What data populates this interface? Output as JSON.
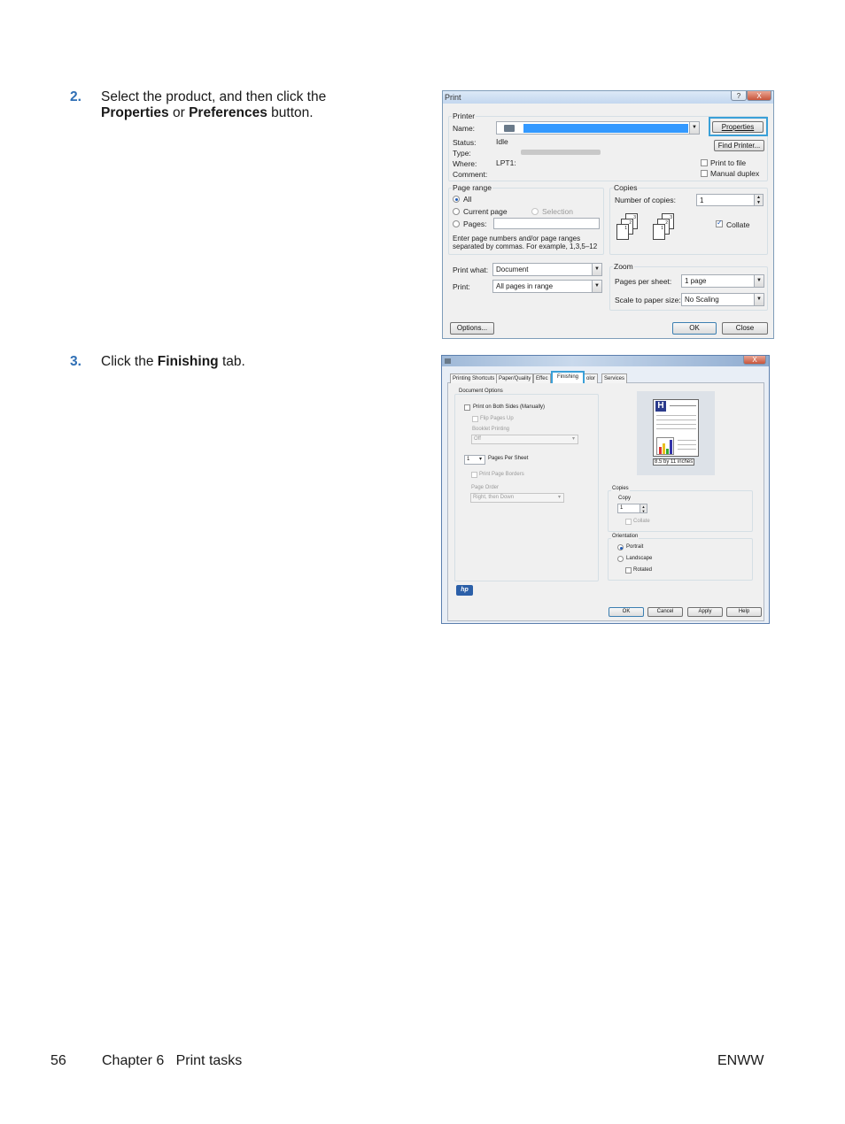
{
  "steps": [
    {
      "number": "2.",
      "line1": "Select the product, and then click the",
      "line2_bold1": "Properties",
      "line2_mid": " or ",
      "line2_bold2": "Preferences",
      "line2_end": " button."
    },
    {
      "number": "3.",
      "pre": "Click the ",
      "bold": "Finishing",
      "post": " tab."
    }
  ],
  "print_dialog": {
    "title": "Print",
    "help_btn": "?",
    "close_btn": "X",
    "printer_group": "Printer",
    "name_label": "Name:",
    "status_label": "Status:",
    "status_value": "Idle",
    "type_label": "Type:",
    "where_label": "Where:",
    "where_value": "LPT1:",
    "comment_label": "Comment:",
    "properties_btn": "Properties",
    "find_printer_btn": "Find Printer...",
    "print_to_file": "Print to file",
    "manual_duplex": "Manual duplex",
    "page_range_group": "Page range",
    "all": "All",
    "current_page": "Current page",
    "selection": "Selection",
    "pages": "Pages:",
    "range_hint_1": "Enter page numbers and/or page ranges",
    "range_hint_2": "separated by commas. For example, 1,3,5–12",
    "copies_group": "Copies",
    "number_of_copies": "Number of copies:",
    "copies_value": "1",
    "collate": "Collate",
    "print_what_label": "Print what:",
    "print_what_value": "Document",
    "print_label": "Print:",
    "print_value": "All pages in range",
    "zoom_group": "Zoom",
    "pages_per_sheet_label": "Pages per sheet:",
    "pages_per_sheet_value": "1 page",
    "scale_label": "Scale to paper size:",
    "scale_value": "No Scaling",
    "options_btn": "Options...",
    "ok_btn": "OK",
    "close_dialog_btn": "Close"
  },
  "props_dialog": {
    "close_btn": "X",
    "tabs": [
      "Printing Shortcuts",
      "Paper/Quality",
      "Effec",
      "Finishing",
      "olor",
      "Services"
    ],
    "doc_options_group": "Document Options",
    "print_both_sides": "Print on Both Sides (Manually)",
    "flip_pages_up": "Flip Pages Up",
    "booklet_printing": "Booklet Printing",
    "booklet_value": "Off",
    "pps_value": "1",
    "pages_per_sheet": "Pages Per Sheet",
    "print_page_borders": "Print Page Borders",
    "page_order": "Page Order",
    "page_order_value": "Right, then Down",
    "preview_caption": "8.5 by 11 inches",
    "copies_group": "Copies",
    "copy_label": "Copy",
    "copy_value": "1",
    "collate": "Collate",
    "orientation_group": "Orientation",
    "portrait": "Portrait",
    "landscape": "Landscape",
    "rotated": "Rotated",
    "ok_btn": "OK",
    "cancel_btn": "Cancel",
    "apply_btn": "Apply",
    "help_btn": "Help",
    "logo": "hp"
  },
  "footer": {
    "page_number": "56",
    "chapter": "Chapter 6   Print tasks",
    "right": "ENWW"
  }
}
